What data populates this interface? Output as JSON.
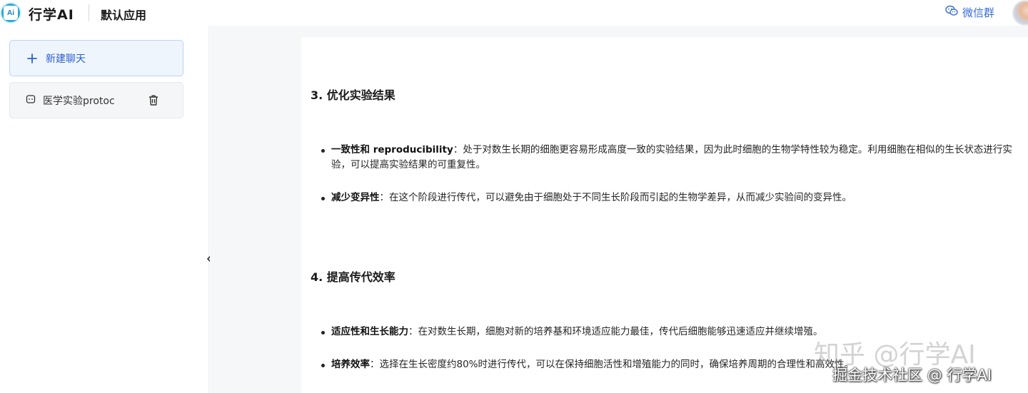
{
  "header": {
    "logo_text": "Ai",
    "brand": "行学AI",
    "app_name": "默认应用",
    "wechat_label": "微信群"
  },
  "sidebar": {
    "new_chat_label": "新建聊天",
    "chats": [
      {
        "title": "医学实验protoc"
      }
    ]
  },
  "content": {
    "sections": [
      {
        "heading": "3. 优化实验结果",
        "items": [
          {
            "term": "一致性和 reproducibility",
            "text": "：处于对数生长期的细胞更容易形成高度一致的实验结果，因为此时细胞的生物学特性较为稳定。利用细胞在相似的生长状态进行实验，可以提高实验结果的可重复性。"
          },
          {
            "term": "减少变异性",
            "text": "：在这个阶段进行传代，可以避免由于细胞处于不同生长阶段而引起的生物学差异，从而减少实验间的变异性。"
          }
        ]
      },
      {
        "heading": "4. 提高传代效率",
        "items": [
          {
            "term": "适应性和生长能力",
            "text": "：在对数生长期，细胞对新的培养基和环境适应能力最佳，传代后细胞能够迅速适应并继续增殖。"
          },
          {
            "term": "培养效率",
            "text": "：选择在生长密度约80%时进行传代，可以在保持细胞活性和增殖能力的同时，确保培养周期的合理性和高效性。"
          }
        ]
      }
    ]
  },
  "watermarks": {
    "zhihu": "知乎 @行学AI",
    "juejin": "掘金技术社区 @ 行学AI"
  },
  "colors": {
    "accent": "#2f5fd0",
    "sidebar_button_bg": "#eef5fd",
    "content_bg": "#f6f7f9"
  }
}
